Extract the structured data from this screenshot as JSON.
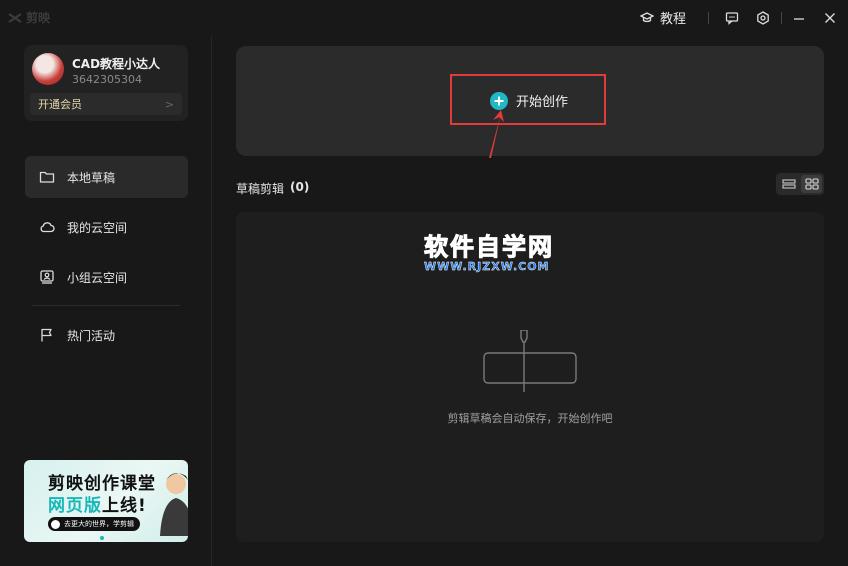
{
  "app": {
    "name": "剪映"
  },
  "topbar": {
    "tutorial_label": "教程"
  },
  "user": {
    "name": "CAD教程小达人",
    "id": "3642305304",
    "vip_label": "开通会员",
    "vip_arrow": ">"
  },
  "sidebar": {
    "items": [
      {
        "label": "本地草稿",
        "icon": "folder-icon",
        "active": true
      },
      {
        "label": "我的云空间",
        "icon": "cloud-icon",
        "active": false
      },
      {
        "label": "小组云空间",
        "icon": "team-space-icon",
        "active": false
      },
      {
        "label": "热门活动",
        "icon": "flag-icon",
        "active": false
      }
    ]
  },
  "promo": {
    "line1": "剪映创作课堂",
    "line2_highlight": "网页版",
    "line2_rest": "上线!",
    "pill_text": "去更大的世界，学剪辑"
  },
  "main": {
    "create_label": "开始创作",
    "drafts_title": "草稿剪辑",
    "drafts_count": "(0)",
    "empty_text": "剪辑草稿会自动保存，开始创作吧"
  },
  "watermark": {
    "big": "软件自学网",
    "small": "WWW.RJZXW.COM"
  },
  "colors": {
    "accent": "#1fb8c4",
    "annotation_red": "#e23b3b",
    "watermark_blue": "#2b7fe8"
  }
}
